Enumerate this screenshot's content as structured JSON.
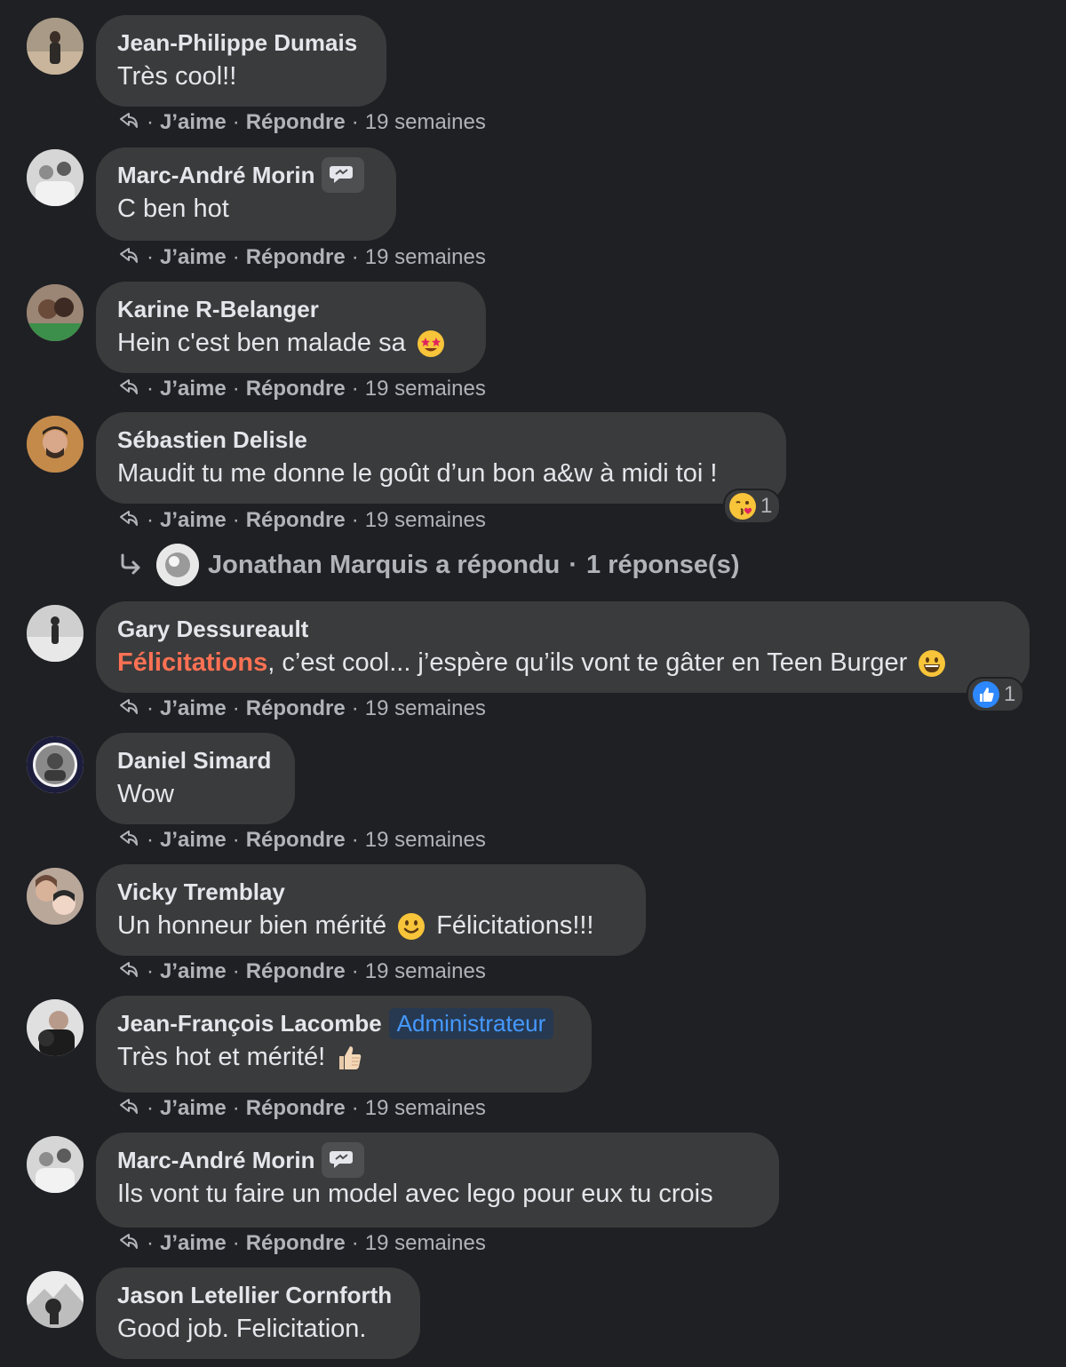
{
  "comments": [
    {
      "name": "Jean-Philippe Dumais",
      "text": "Très cool!!",
      "like": "J’aime",
      "reply": "Répondre",
      "time": "19 semaines"
    },
    {
      "name": "Marc-André Morin",
      "text": "C ben hot",
      "like": "J’aime",
      "reply": "Répondre",
      "time": "19 semaines"
    },
    {
      "name": "Karine R-Belanger",
      "text": "Hein c'est ben malade sa",
      "emoji": "star-struck-emoji",
      "like": "J’aime",
      "reply": "Répondre",
      "time": "19 semaines"
    },
    {
      "name": "Sébastien Delisle",
      "text": "Maudit tu me donne le goût d’un bon a&w à midi toi !",
      "reaction": {
        "icon": "kiss-emoji",
        "count": "1"
      },
      "like": "J’aime",
      "reply": "Répondre",
      "time": "19 semaines",
      "replies": {
        "author_text": "Jonathan Marquis a répondu",
        "separator": "·",
        "count_text": "1 réponse(s)"
      }
    },
    {
      "name": "Gary Dessureault",
      "highlight": "Félicitations",
      "text": ", c’est cool... j’espère qu’ils vont te gâter en Teen Burger",
      "emoji": "grinning-emoji",
      "reaction": {
        "icon": "like-icon",
        "count": "1"
      },
      "like": "J’aime",
      "reply": "Répondre",
      "time": "19 semaines"
    },
    {
      "name": "Daniel Simard",
      "text": "Wow",
      "like": "J’aime",
      "reply": "Répondre",
      "time": "19 semaines"
    },
    {
      "name": "Vicky Tremblay",
      "text": "Un honneur bien mérité",
      "emoji": "smiling-emoji",
      "text2": "Félicitations!!!",
      "like": "J’aime",
      "reply": "Répondre",
      "time": "19 semaines"
    },
    {
      "name": "Jean-François Lacombe",
      "badge": "Administrateur",
      "text": "Très hot et mérité!",
      "emoji": "thumbs-up-emoji",
      "like": "J’aime",
      "reply": "Répondre",
      "time": "19 semaines"
    },
    {
      "name": "Marc-André Morin",
      "text": "Ils vont tu faire un model avec lego pour eux tu crois",
      "like": "J’aime",
      "reply": "Répondre",
      "time": "19 semaines"
    },
    {
      "name": "Jason Letellier Cornforth",
      "text": "Good job. Felicitation."
    }
  ],
  "colors": {
    "background": "#1f2024",
    "bubble": "#3a3b3c",
    "highlight": "#ff7154",
    "admin": "#4599ff",
    "muted": "#b0b3b8"
  }
}
